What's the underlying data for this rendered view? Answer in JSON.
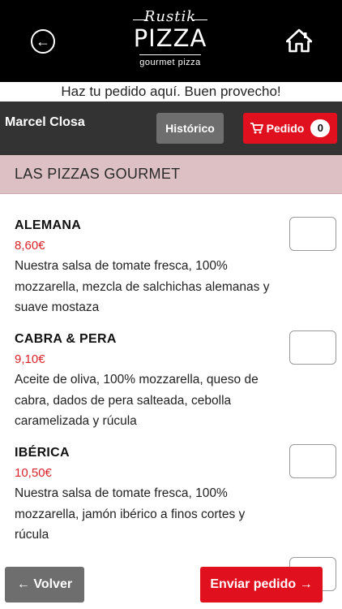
{
  "header": {
    "logo_top": "Rustik",
    "logo_main": "PIZZA",
    "logo_sub": "gourmet pizza",
    "back_icon": "back-arrow-circle-icon",
    "home_icon": "home-icon"
  },
  "welcome_text": "Haz tu pedido aquí. Buen provecho!",
  "user": {
    "name": "Marcel Closa"
  },
  "buttons": {
    "history_label": "Histórico",
    "order_label": "Pedido",
    "order_count": "0",
    "back_label": "← Volver",
    "send_label": "Enviar pedido →"
  },
  "section": {
    "title": "LAS PIZZAS GOURMET"
  },
  "items": [
    {
      "name": "ALEMANA",
      "price": "8,60€",
      "description": "Nuestra salsa de tomate fresca, 100% mozzarella, mezcla de salchichas alemanas y suave mostaza"
    },
    {
      "name": "CABRA & PERA",
      "price": "9,10€",
      "description": "Aceite de oliva, 100% mozzarella, queso de cabra, dados de pera salteada, cebolla caramelizada y rúcula"
    },
    {
      "name": "IBÉRICA",
      "price": "10,50€",
      "description": "Nuestra salsa de tomate fresca, 100% mozzarella, jamón ibérico a finos cortes y rúcula"
    }
  ],
  "colors": {
    "accent_red": "#e0101f",
    "price_red": "#d8232a",
    "section_bg": "#dcc0c3",
    "bar_dark": "#333333",
    "button_gray": "#6e6e6e"
  }
}
